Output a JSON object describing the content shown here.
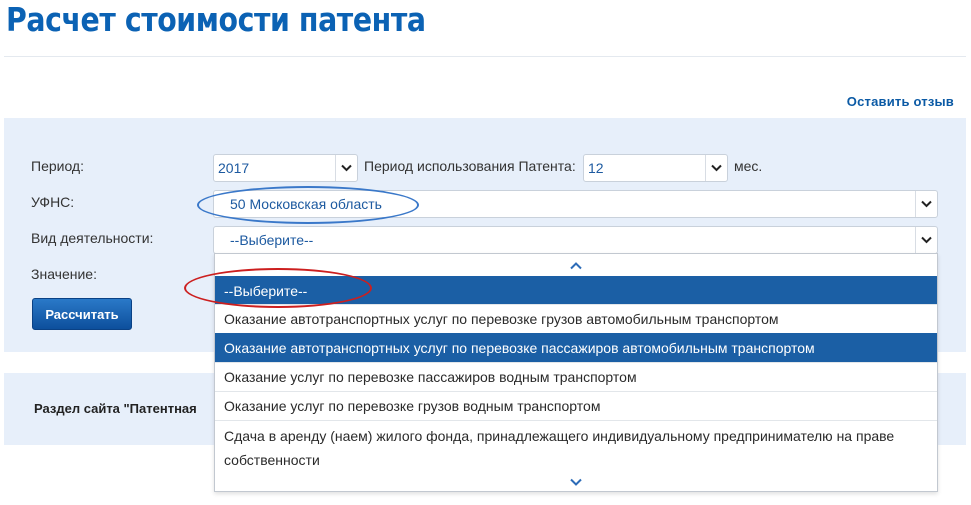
{
  "page": {
    "title": "Расчет стоимости патента"
  },
  "feedback_link": "Оставить отзыв",
  "form": {
    "period_label": "Период:",
    "period_value": "2017",
    "usage_label": "Период использования Патента:",
    "usage_value": "12",
    "usage_unit": "мес.",
    "ufns_label": "УФНС:",
    "ufns_value": "50 Московская область",
    "activity_label": "Вид деятельности:",
    "activity_value": "--Выберите--",
    "value_label": "Значение:",
    "calc_button": "Рассчитать"
  },
  "activity_options": [
    "--Выберите--",
    "Оказание автотранспортных услуг по перевозке грузов автомобильным транспортом",
    "Оказание автотранспортных услуг по перевозке пассажиров автомобильным транспортом",
    "Оказание услуг по перевозке пассажиров водным транспортом",
    "Оказание услуг по перевозке грузов водным транспортом",
    "Сдача в аренду (наем) жилого фонда, принадлежащего индивидуальному предпринимателю на праве собственности"
  ],
  "info": {
    "text": "Раздел сайта \"Патентная"
  },
  "icons": {
    "select_chevron": "chevron-down-icon",
    "scroll_up": "chevron-up-icon",
    "scroll_down": "chevron-down-icon"
  },
  "colors": {
    "brand_blue": "#0b62b4",
    "panel_bg": "#e7effa",
    "highlight": "#1b5fa5",
    "annotation_blue": "#3a78c9",
    "annotation_red": "#cc1f1f"
  }
}
